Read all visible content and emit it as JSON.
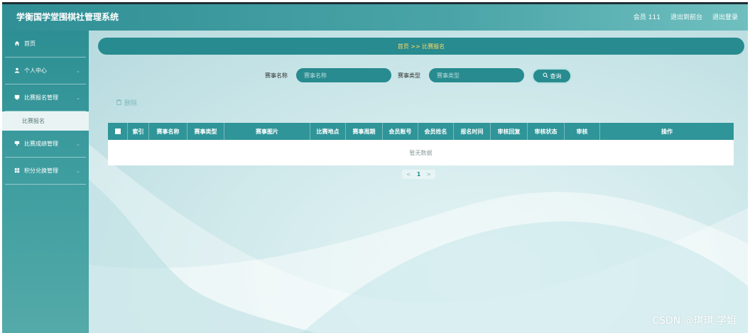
{
  "header": {
    "title": "学衡国学堂围棋社管理系统",
    "user": "会员 111",
    "back_to_dashboard": "退出到前台",
    "logout": "退出登录"
  },
  "sidebar": {
    "items": [
      {
        "label": "首页",
        "icon": "home-icon"
      },
      {
        "label": "个人中心",
        "icon": "user-icon"
      },
      {
        "label": "比赛报名管理",
        "icon": "list-icon"
      },
      {
        "label": "比赛成绩管理",
        "icon": "list-icon"
      },
      {
        "label": "积分兑换管理",
        "icon": "grid-icon"
      }
    ],
    "active_sub": "比赛报名"
  },
  "breadcrumb": {
    "text": "首页 >> 比赛报名"
  },
  "search": {
    "name_label": "赛事名称",
    "name_placeholder": "赛事名称",
    "type_label": "赛事类型",
    "type_placeholder": "赛事类型",
    "query_label": "查询"
  },
  "toolbar": {
    "delete_label": "删除"
  },
  "table": {
    "columns": [
      "索引",
      "赛事名称",
      "赛事类型",
      "赛事图片",
      "比赛地点",
      "赛事周期",
      "会员账号",
      "会员姓名",
      "报名时间",
      "审核回复",
      "审核状态",
      "审核",
      "操作"
    ],
    "empty_text": "暂无数据"
  },
  "pagination": {
    "prev": "<",
    "current": "1",
    "next": ">"
  },
  "watermark": "CSDN @琪琪 学姐",
  "colors": {
    "primary": "#278b8f",
    "header": "#2f8f95",
    "breadcrumb_text": "#ffd966"
  }
}
